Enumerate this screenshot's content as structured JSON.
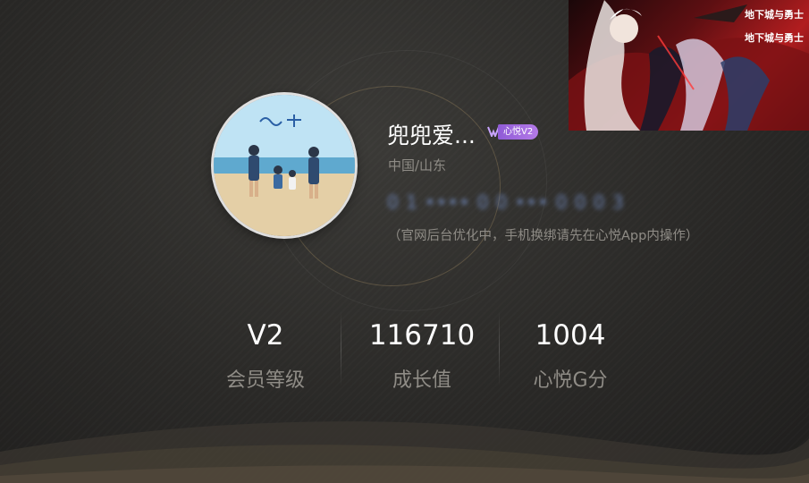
{
  "profile": {
    "username": "兜兜爱...",
    "vip_badge": "心悦V2",
    "location": "中国/山东",
    "phone_masked": "0 1 •••• 0 0 ••• 0 0 0 3",
    "notice": "（官网后台优化中，手机换绑请先在心悦App内操作）"
  },
  "stats": [
    {
      "value": "V2",
      "label": "会员等级"
    },
    {
      "value": "116710",
      "label": "成长值"
    },
    {
      "value": "1004",
      "label": "心悦G分"
    }
  ],
  "ad": {
    "logo_line1": "地下城与勇士",
    "logo_line2": "地下城与勇士"
  },
  "colors": {
    "background": "#2a2927",
    "vip_purple": "#9b68e0",
    "muted_text": "#8f8c86",
    "ad_red": "#b11d1f"
  }
}
